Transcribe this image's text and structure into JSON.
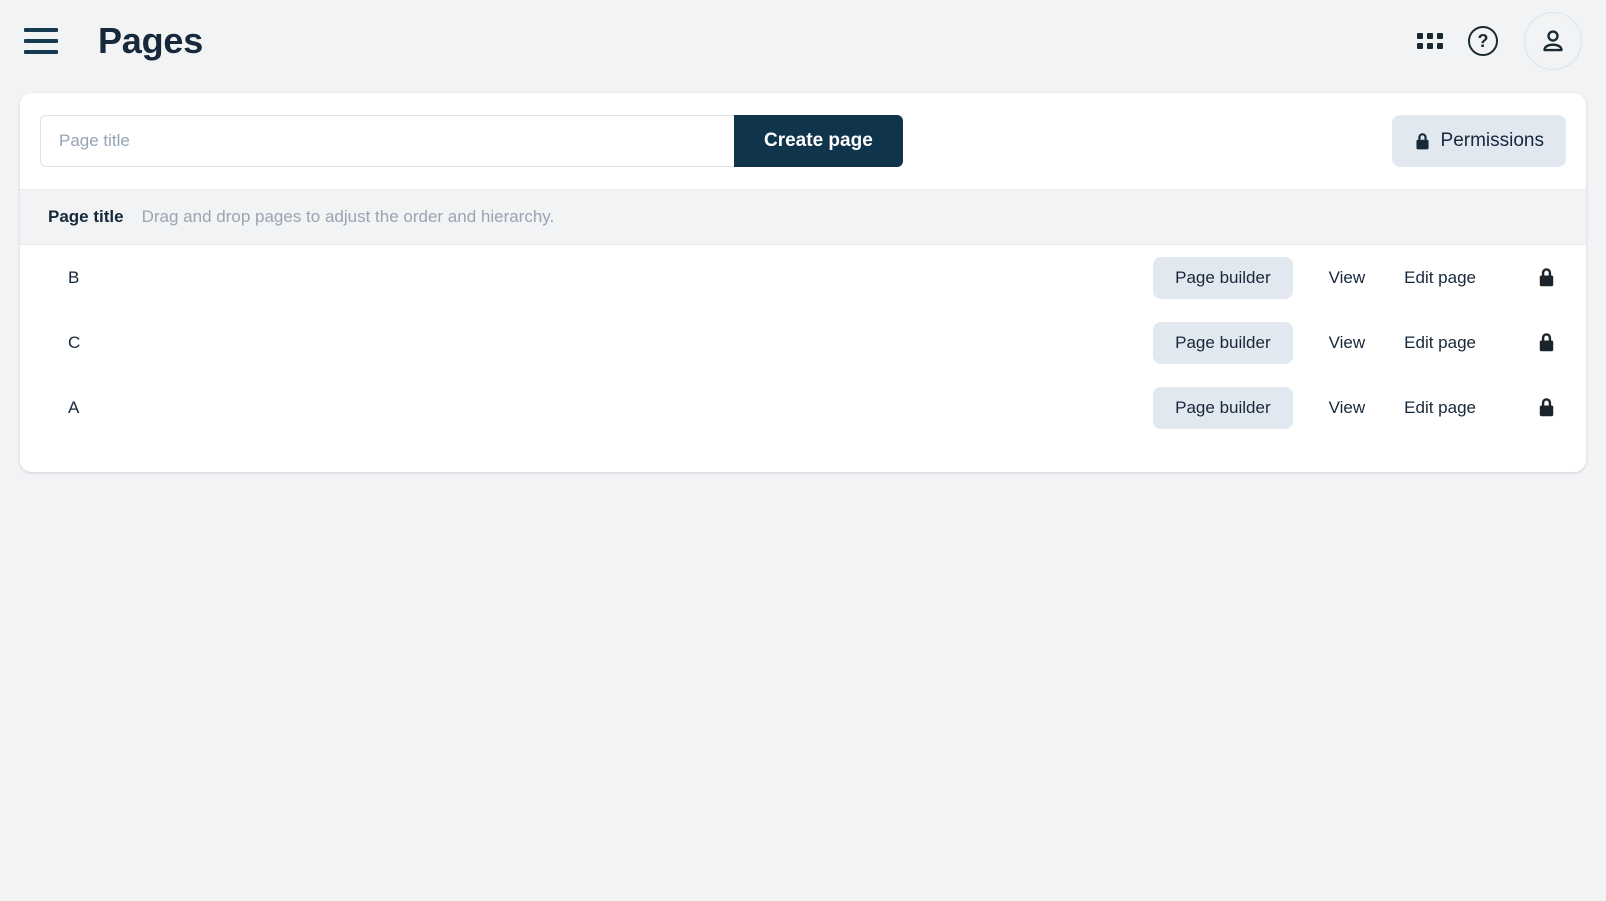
{
  "topbar": {
    "menu_icon": "hamburger-menu-icon",
    "title": "Pages",
    "apps_icon": "apps-grid-icon",
    "help_icon": "help-circle-icon",
    "help_glyph": "?",
    "account_icon": "user-avatar-icon"
  },
  "toolbar": {
    "title_placeholder": "Page title",
    "title_value": "",
    "create_label": "Create page",
    "permissions_label": "Permissions",
    "permissions_icon": "lock-icon"
  },
  "table": {
    "header": {
      "column_label": "Page title",
      "hint": "Drag and drop pages to adjust the order and hierarchy."
    },
    "actions": {
      "page_builder": "Page builder",
      "view": "View",
      "edit_page": "Edit page",
      "lock_icon": "lock-icon"
    },
    "rows": [
      {
        "title": "B"
      },
      {
        "title": "C"
      },
      {
        "title": "A"
      }
    ]
  },
  "colors": {
    "page_background": "#f1f3f5",
    "card_background": "#ffffff",
    "primary_dark": "#10344b",
    "accent_soft": "#e2e8f0",
    "text_dark": "#16283a",
    "text_muted": "#9aa4b2"
  }
}
